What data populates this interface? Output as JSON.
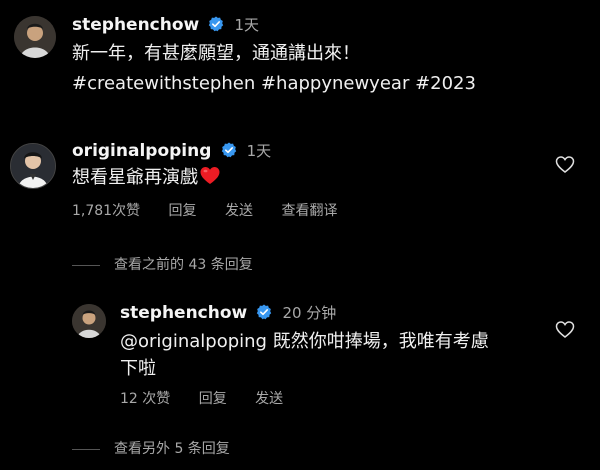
{
  "post": {
    "username": "stephenchow",
    "time": "1天",
    "caption_line1": "新一年，有甚麼願望，通通講出來！",
    "caption_line2": "#createwithstephen #happynewyear #2023"
  },
  "comment": {
    "username": "originalpoping",
    "time": "1天",
    "text": "想看星爺再演戲",
    "emoji": "red-heart",
    "likes": "1,781次赞",
    "reply_label": "回复",
    "send_label": "发送",
    "translate_label": "查看翻译",
    "view_previous": "查看之前的 43 条回复"
  },
  "reply": {
    "username": "stephenchow",
    "time": "20 分钟",
    "text_line1": "@originalpoping 既然你咁捧場，我唯有考慮",
    "text_line2": "下啦",
    "likes": "12 次赞",
    "reply_label": "回复",
    "send_label": "发送",
    "view_more": "查看另外 5 条回复"
  },
  "colors": {
    "background": "#000000",
    "verified_blue": "#3897f0",
    "secondary_text": "#a8a8a8",
    "heart_red": "#ed1c24"
  }
}
